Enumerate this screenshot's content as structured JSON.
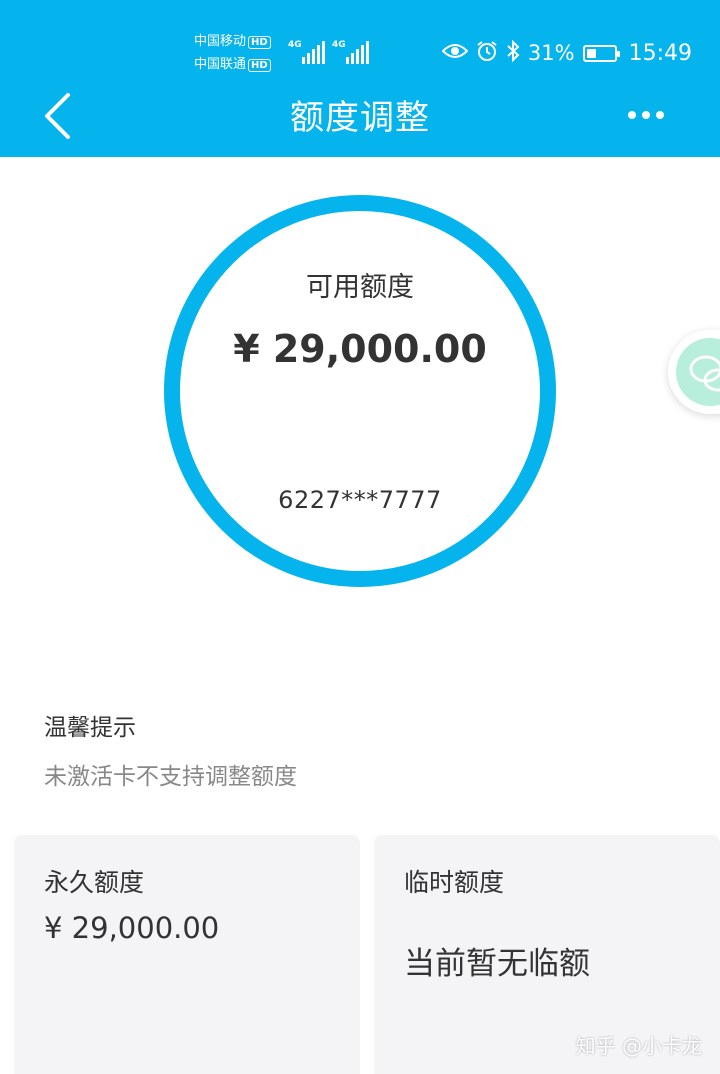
{
  "status_bar": {
    "carrier1": "中国移动",
    "carrier2": "中国联通",
    "hd": "HD",
    "net1": "4G",
    "net2": "4G",
    "battery": "31%",
    "time": "15:49"
  },
  "header": {
    "title": "额度调整"
  },
  "circle": {
    "label": "可用额度",
    "amount": "¥ 29,000.00",
    "card_number": "6227***7777"
  },
  "tips": {
    "title": "温馨提示",
    "text": "未激活卡不支持调整额度"
  },
  "cards": {
    "permanent": {
      "label": "永久额度",
      "amount": "¥ 29,000.00"
    },
    "temporary": {
      "label": "临时额度",
      "text": "当前暂无临额"
    }
  },
  "watermark": "知乎 @小卡龙",
  "colors": {
    "accent": "#06b4ed",
    "card_bg": "#f4f4f6",
    "muted_text": "#888888"
  }
}
